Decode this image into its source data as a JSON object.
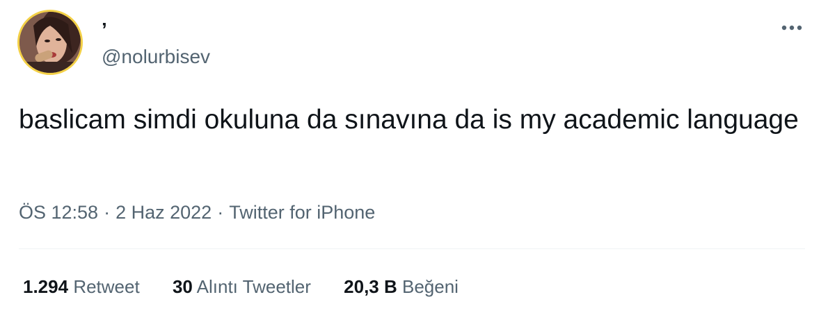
{
  "user": {
    "display_name": "’",
    "handle": "@nolurbisev",
    "avatar_ring_color": "#f3d046"
  },
  "more_menu": {
    "icon": "more-horizontal-icon"
  },
  "tweet": {
    "text": "baslicam simdi okuluna da sınavına da is my academic language"
  },
  "meta": {
    "time": "ÖS 12:58",
    "separator": "·",
    "date": "2 Haz 2022",
    "source": "Twitter for iPhone"
  },
  "stats": [
    {
      "count": "1.294",
      "label": "Retweet"
    },
    {
      "count": "30",
      "label": "Alıntı Tweetler"
    },
    {
      "count": "20,3 B",
      "label": "Beğeni"
    }
  ],
  "colors": {
    "text_primary": "#0f1419",
    "text_secondary": "#536471",
    "divider": "#eff3f4"
  }
}
